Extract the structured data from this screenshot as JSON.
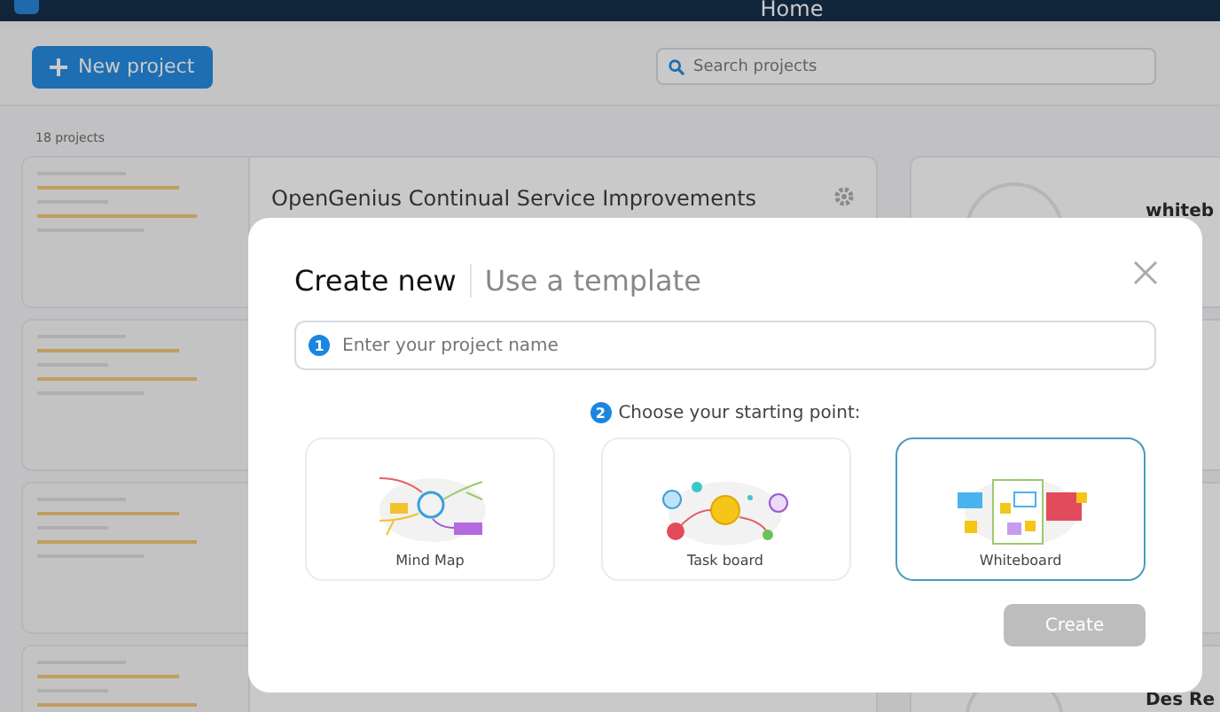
{
  "top_bar": {
    "title": "Home"
  },
  "toolbar": {
    "new_project": "New project",
    "search": {
      "placeholder": "Search projects"
    }
  },
  "project_count": "18 projects",
  "projects": [
    {
      "title": "OpenGenius Continual Service Improvements",
      "side_title": "whiteb"
    },
    {
      "side_title": "Des Re"
    }
  ],
  "dialog": {
    "tabs": [
      {
        "label": "Create new",
        "selected": true
      },
      {
        "label": "Use a template",
        "selected": false
      }
    ],
    "name_field": {
      "step": "1",
      "placeholder": "Enter your project name"
    },
    "starting_point": {
      "step": "2",
      "label": "Choose your starting point:"
    },
    "options": [
      {
        "kind": "mindmap",
        "label": "Mind Map",
        "selected": false
      },
      {
        "kind": "taskboard",
        "label": "Task board",
        "selected": false
      },
      {
        "kind": "whiteboard",
        "label": "Whiteboard",
        "selected": true
      }
    ],
    "create_button": {
      "label": "Create",
      "disabled": true
    }
  }
}
